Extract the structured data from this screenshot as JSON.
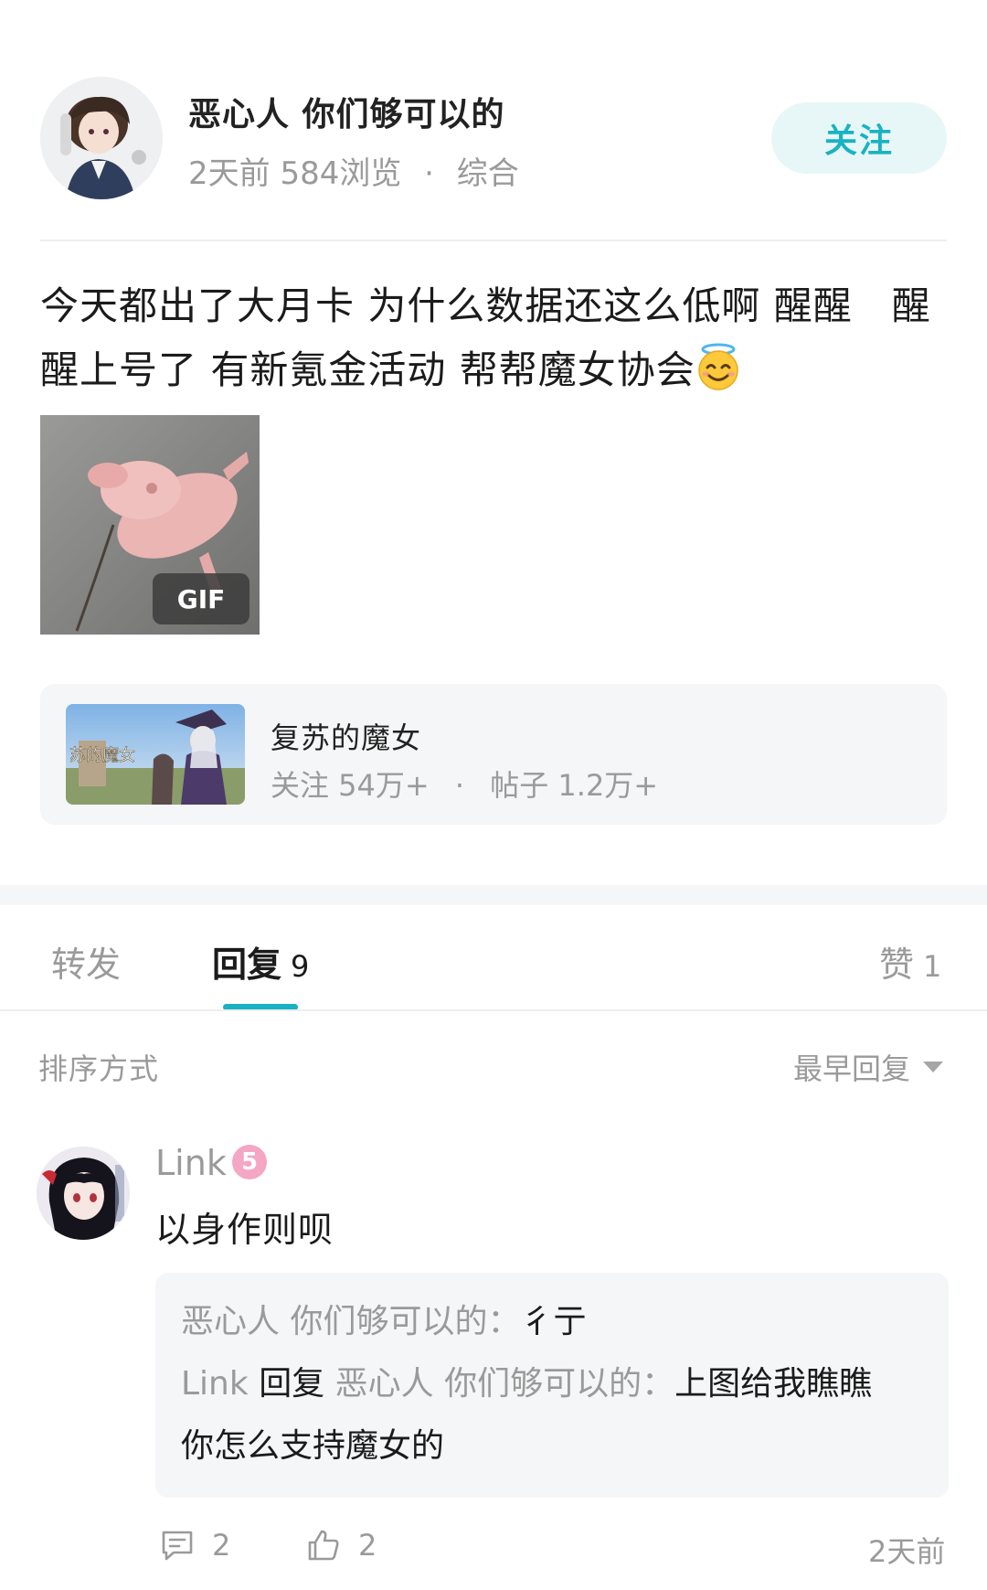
{
  "post": {
    "author": "恶心人 你们够可以的",
    "time": "2天前",
    "views": "584浏览",
    "category": "综合",
    "follow_label": "关注",
    "content_line1": "今天都出了大月卡 为什么数据还这么低啊 醒醒　醒",
    "content_line2": "醒上号了 有新氪金活动 帮帮魔女协会",
    "emoji": "smiling-face-with-halo",
    "gif_badge": "GIF"
  },
  "circle": {
    "name": "复苏的魔女",
    "followers": "关注 54万+",
    "posts": "帖子 1.2万+",
    "cover_text": "苏的魔女"
  },
  "tabs": {
    "repost": "转发",
    "reply": "回复",
    "reply_count": "9",
    "like": "赞",
    "like_count": "1"
  },
  "sort": {
    "label": "排序方式",
    "value": "最早回复"
  },
  "comment": {
    "user": "Link",
    "level": "5",
    "text": "以身作则呗",
    "replies": {
      "r1_user": "恶心人 你们够可以的",
      "r1_text": "彳亍",
      "r2_user": "Link",
      "r2_verb": "回复",
      "r2_target": "恶心人 你们够可以的",
      "r2_text": "上图给我瞧瞧",
      "r2_text_cont": "你怎么支持魔女的"
    },
    "comment_count": "2",
    "like_count": "2",
    "time": "2天前"
  },
  "colors": {
    "accent": "#19b2c2",
    "follow_bg": "#e7f7f8",
    "muted_text": "#9a9a9a",
    "card_bg": "#f4f6f7"
  }
}
